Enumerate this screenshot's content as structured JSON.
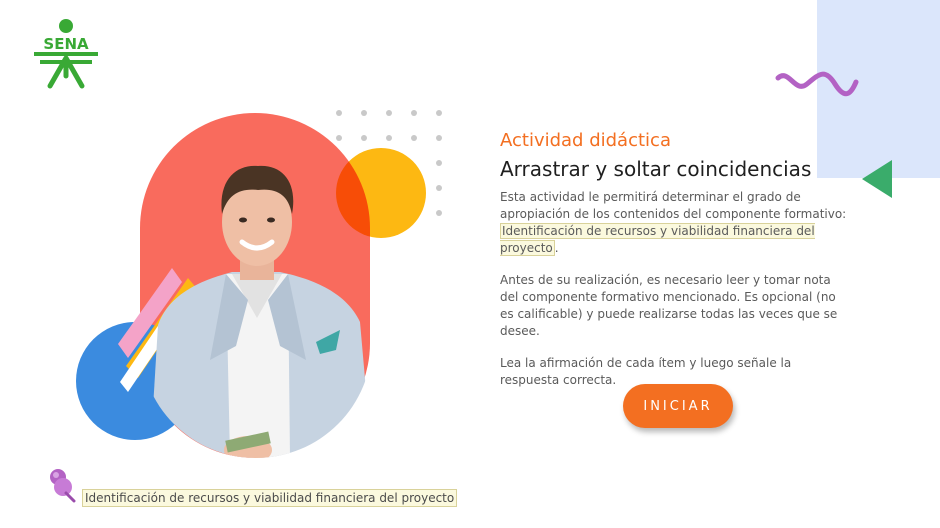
{
  "logo": {
    "text": "SENA",
    "color": "#39a935"
  },
  "decor": {
    "panel_color": "#dbe6fb",
    "squiggle_color": "#b362c4",
    "triangle_color": "#3aac6b",
    "pill_color": "#f96b5d",
    "yellow_circle_color": "#fdb812",
    "blue_circle_color": "#3b8bdf"
  },
  "content": {
    "kicker": "Actividad didáctica",
    "title": "Arrastrar y soltar coincidencias",
    "p1_prefix": "Esta actividad le permitirá determinar el grado de apropiación de los contenidos del componente formativo: ",
    "p1_highlight": "Identificación de recursos y viabilidad financiera del proyecto",
    "p1_suffix": ".",
    "p2": "Antes de su realización, es necesario leer y tomar nota del componente formativo mencionado.  Es opcional (no es calificable) y puede realizarse todas las veces que se desee.",
    "p3": "Lea la afirmación de cada ítem y luego señale la respuesta correcta."
  },
  "start_button": {
    "label": "INICIAR",
    "color": "#f36f21"
  },
  "footer": {
    "icon": "pushpin-icon",
    "text": "Identificación de recursos y viabilidad financiera del proyecto"
  }
}
